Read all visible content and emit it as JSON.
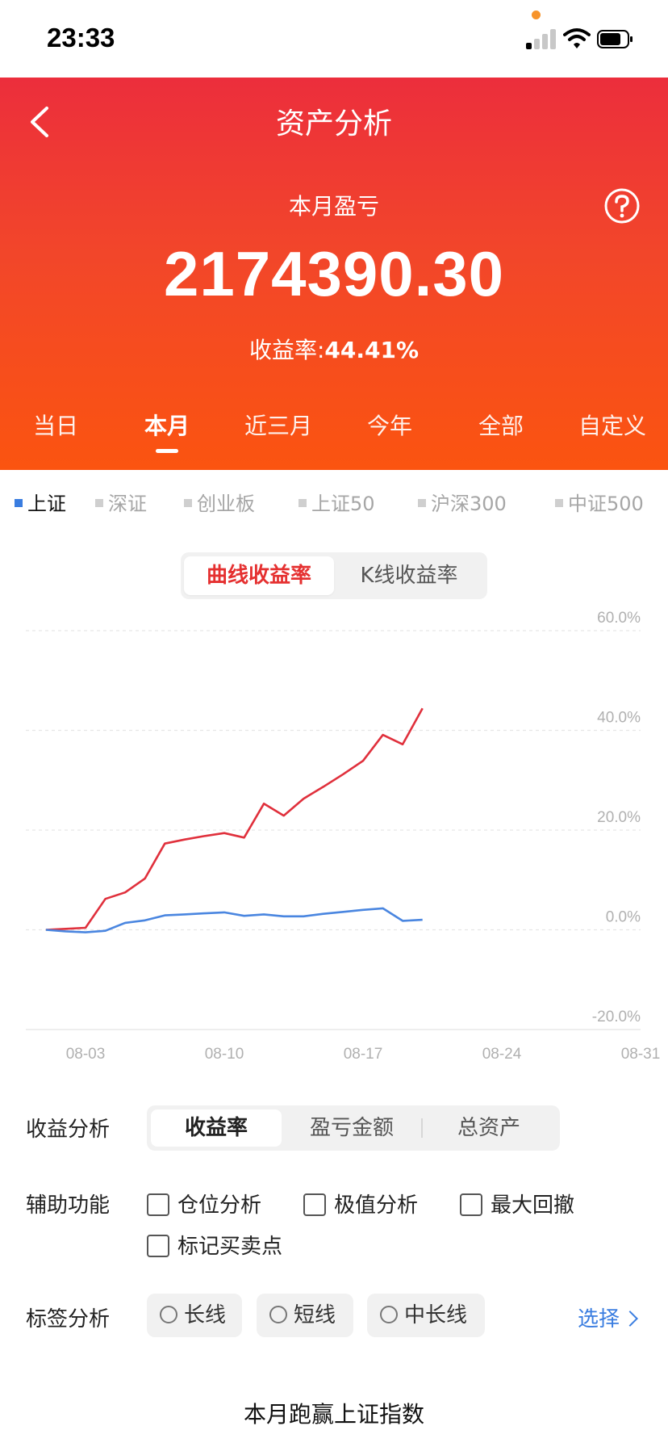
{
  "status_bar": {
    "time": "23:33"
  },
  "header": {
    "title": "资产分析",
    "period_label": "本月盈亏",
    "pnl_value": "2174390.30",
    "yield_label": "收益率:",
    "yield_value": "44.41%"
  },
  "period_tabs": [
    "当日",
    "本月",
    "近三月",
    "今年",
    "全部",
    "自定义"
  ],
  "active_period": "本月",
  "index_tabs": [
    "上证",
    "深证",
    "创业板",
    "上证50",
    "沪深300",
    "中证500"
  ],
  "active_index": "上证",
  "chart_mode": {
    "options": [
      "曲线收益率",
      "K线收益率"
    ],
    "active": "曲线收益率"
  },
  "chart_data": {
    "type": "line",
    "x_ticks": [
      "08-03",
      "08-10",
      "08-17",
      "08-24",
      "08-31"
    ],
    "y_ticks": [
      "60.0%",
      "40.0%",
      "20.0%",
      "0.0%",
      "-20.0%"
    ],
    "ylim": [
      -20,
      60
    ],
    "grid": true,
    "series": [
      {
        "color": "#e0303c",
        "x": [
          "08-01",
          "08-02",
          "08-03",
          "08-04",
          "08-05",
          "08-06",
          "08-07",
          "08-08",
          "08-09",
          "08-10",
          "08-11",
          "08-12",
          "08-13",
          "08-14",
          "08-15",
          "08-16",
          "08-17",
          "08-18",
          "08-19",
          "08-20"
        ],
        "values": [
          0.0,
          0.2,
          0.4,
          6.2,
          7.5,
          10.3,
          17.3,
          18.1,
          18.8,
          19.4,
          18.5,
          25.3,
          22.9,
          26.3,
          28.7,
          31.2,
          33.9,
          39.1,
          37.2,
          44.41
        ]
      },
      {
        "color": "#4a86e0",
        "x": [
          "08-01",
          "08-02",
          "08-03",
          "08-04",
          "08-05",
          "08-06",
          "08-07",
          "08-08",
          "08-09",
          "08-10",
          "08-11",
          "08-12",
          "08-13",
          "08-14",
          "08-15",
          "08-16",
          "08-17",
          "08-18",
          "08-19",
          "08-20"
        ],
        "values": [
          0.0,
          -0.3,
          -0.5,
          -0.2,
          1.4,
          1.9,
          2.9,
          3.1,
          3.3,
          3.5,
          2.8,
          3.1,
          2.7,
          2.7,
          3.2,
          3.6,
          4.0,
          4.3,
          1.8,
          2.0
        ]
      }
    ]
  },
  "analysis": {
    "yield_label": "收益分析",
    "modes": [
      "收益率",
      "盈亏金额",
      "总资产"
    ],
    "active_mode": "收益率",
    "aux_label": "辅助功能",
    "aux_options": [
      "仓位分析",
      "极值分析",
      "最大回撤",
      "标记买卖点"
    ],
    "tag_label": "标签分析",
    "tags": [
      "长线",
      "短线",
      "中长线"
    ],
    "select_label": "选择"
  },
  "footer": {
    "title": "本月跑赢上证指数"
  },
  "colors": {
    "header_top": "#ec2e3c",
    "header_bottom": "#fb5410",
    "accent_red": "#e53030",
    "link_blue": "#3a7de0"
  }
}
